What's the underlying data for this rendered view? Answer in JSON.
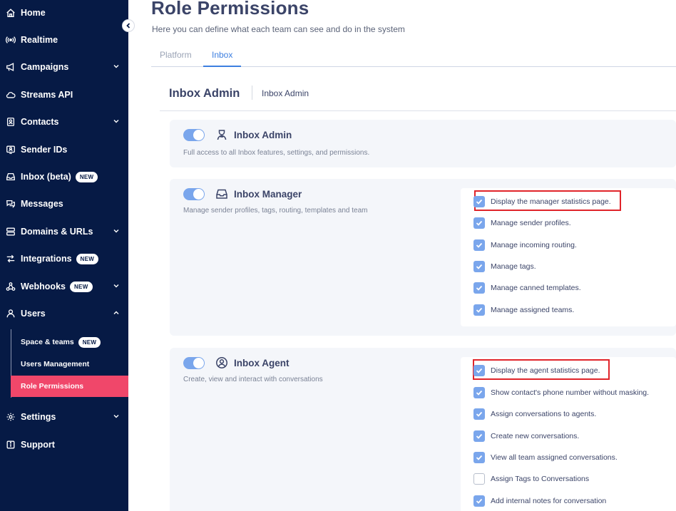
{
  "sidebar": {
    "items": [
      {
        "label": "Home",
        "icon": "home-icon"
      },
      {
        "label": "Realtime",
        "icon": "broadcast-icon"
      },
      {
        "label": "Campaigns",
        "icon": "megaphone-icon",
        "chevron": "down"
      },
      {
        "label": "Streams API",
        "icon": "cloud-icon"
      },
      {
        "label": "Contacts",
        "icon": "contact-card-icon",
        "chevron": "down"
      },
      {
        "label": "Sender IDs",
        "icon": "id-badge-icon"
      },
      {
        "label": "Inbox (beta)",
        "icon": "inbox-icon",
        "badge": "NEW"
      },
      {
        "label": "Messages",
        "icon": "chat-bubbles-icon"
      },
      {
        "label": "Domains & URLs",
        "icon": "server-icon",
        "chevron": "down"
      },
      {
        "label": "Integrations",
        "icon": "integration-arrows-icon",
        "badge": "NEW"
      },
      {
        "label": "Webhooks",
        "icon": "webhook-icon",
        "badge": "NEW",
        "chevron": "down"
      },
      {
        "label": "Users",
        "icon": "user-icon",
        "chevron": "up"
      },
      {
        "label": "Settings",
        "icon": "gear-icon",
        "chevron": "down"
      },
      {
        "label": "Support",
        "icon": "info-icon"
      }
    ],
    "users_submenu": [
      {
        "label": "Space & teams",
        "badge": "NEW"
      },
      {
        "label": "Users Management"
      },
      {
        "label": "Role Permissions",
        "active": true
      }
    ]
  },
  "header": {
    "title": "Role Permissions",
    "subtitle": "Here you can define what each team can see and do in the system"
  },
  "tabs": [
    {
      "label": "Platform",
      "active": false
    },
    {
      "label": "Inbox",
      "active": true
    }
  ],
  "card": {
    "title": "Inbox Admin",
    "subtitle": "Inbox Admin"
  },
  "roles": [
    {
      "name": "Inbox Admin",
      "icon": "admin-user-icon",
      "enabled": true,
      "description": "Full access to all Inbox features, settings, and permissions.",
      "permissions": []
    },
    {
      "name": "Inbox Manager",
      "icon": "inbox-tray-icon",
      "enabled": true,
      "description": "Manage sender profiles, tags, routing, templates and team",
      "permissions": [
        {
          "label": "Display the manager statistics page.",
          "checked": true,
          "highlighted": true
        },
        {
          "label": "Manage sender profiles.",
          "checked": true
        },
        {
          "label": "Manage incoming routing.",
          "checked": true
        },
        {
          "label": "Manage tags.",
          "checked": true
        },
        {
          "label": "Manage canned templates.",
          "checked": true
        },
        {
          "label": "Manage assigned teams.",
          "checked": true
        }
      ]
    },
    {
      "name": "Inbox Agent",
      "icon": "user-circle-icon",
      "enabled": true,
      "description": "Create, view and interact with conversations",
      "permissions": [
        {
          "label": "Display the agent statistics page.",
          "checked": true,
          "highlighted": true
        },
        {
          "label": "Show contact's phone number without masking.",
          "checked": true
        },
        {
          "label": "Assign conversations to agents.",
          "checked": true
        },
        {
          "label": "Create new conversations.",
          "checked": true
        },
        {
          "label": "View all team assigned conversations.",
          "checked": true
        },
        {
          "label": "Assign Tags to Conversations",
          "checked": false
        },
        {
          "label": "Add internal notes for conversation",
          "checked": true
        }
      ]
    }
  ],
  "colors": {
    "sidebar_bg": "#061a45",
    "active_item": "#f0476a",
    "accent": "#7aa6ec",
    "tab_active": "#3d7fe0",
    "highlight_border": "#e0242a"
  }
}
